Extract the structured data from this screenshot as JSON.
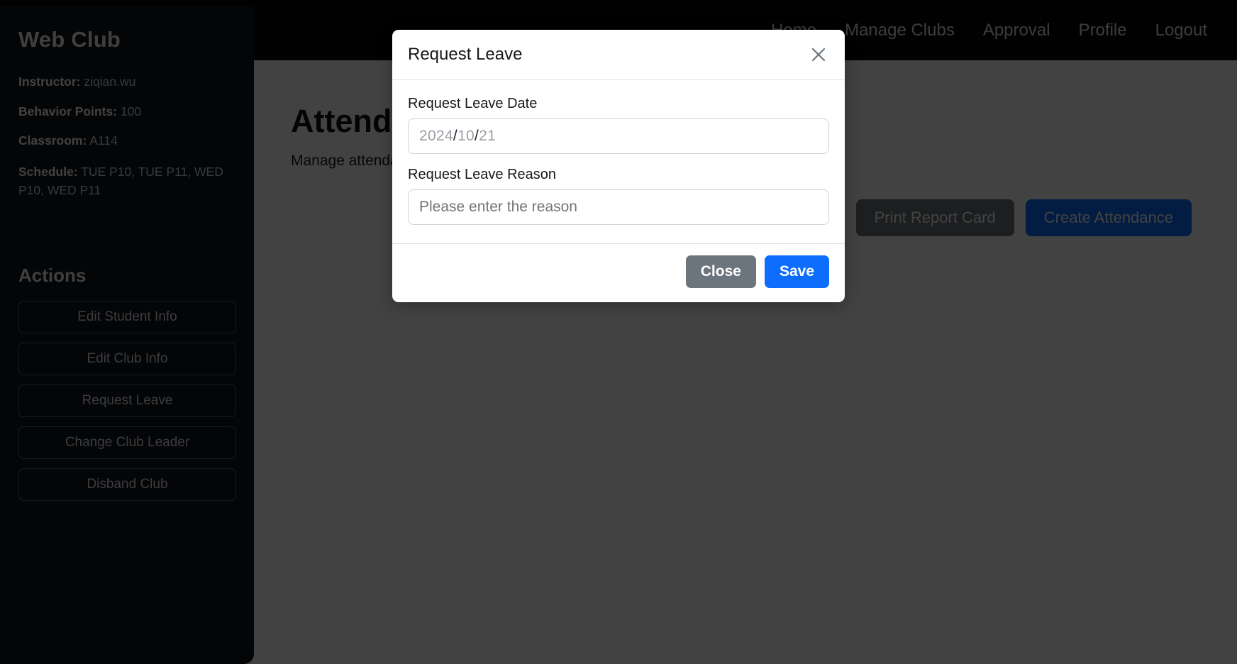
{
  "navbar": {
    "links": [
      {
        "label": "Home"
      },
      {
        "label": "Manage Clubs"
      },
      {
        "label": "Approval"
      },
      {
        "label": "Profile"
      },
      {
        "label": "Logout"
      }
    ]
  },
  "sidebar": {
    "club_title": "Web Club",
    "meta": [
      {
        "key": "Instructor:",
        "value": "ziqian.wu"
      },
      {
        "key": "Behavior Points:",
        "value": "100"
      },
      {
        "key": "Classroom:",
        "value": "A114"
      },
      {
        "key": "Schedule:",
        "value": "TUE P10, TUE P11, WED P10, WED P11"
      }
    ],
    "actions_title": "Actions",
    "actions": [
      {
        "label": "Edit Student Info"
      },
      {
        "label": "Edit Club Info"
      },
      {
        "label": "Request Leave"
      },
      {
        "label": "Change Club Leader"
      },
      {
        "label": "Disband Club"
      }
    ]
  },
  "content": {
    "heading": "Attendance Management",
    "subtitle": "Manage attendance records.",
    "print_report_label": "Print Report Card",
    "create_attendance_label": "Create Attendance"
  },
  "modal": {
    "title": "Request Leave",
    "close_icon": "close-icon",
    "date_field": {
      "label": "Request Leave Date",
      "year": "2024",
      "sep1": "/",
      "month": "10",
      "sep2": "/",
      "day": "21"
    },
    "reason_field": {
      "label": "Request Leave Reason",
      "placeholder": "Please enter the reason",
      "value": ""
    },
    "close_label": "Close",
    "save_label": "Save"
  },
  "colors": {
    "primary": "#0d6efd",
    "secondary": "#6c757d",
    "navbar_bg": "#050608",
    "sidebar_bg": "#10151c",
    "overlay": "rgba(0,0,0,0.74)"
  }
}
